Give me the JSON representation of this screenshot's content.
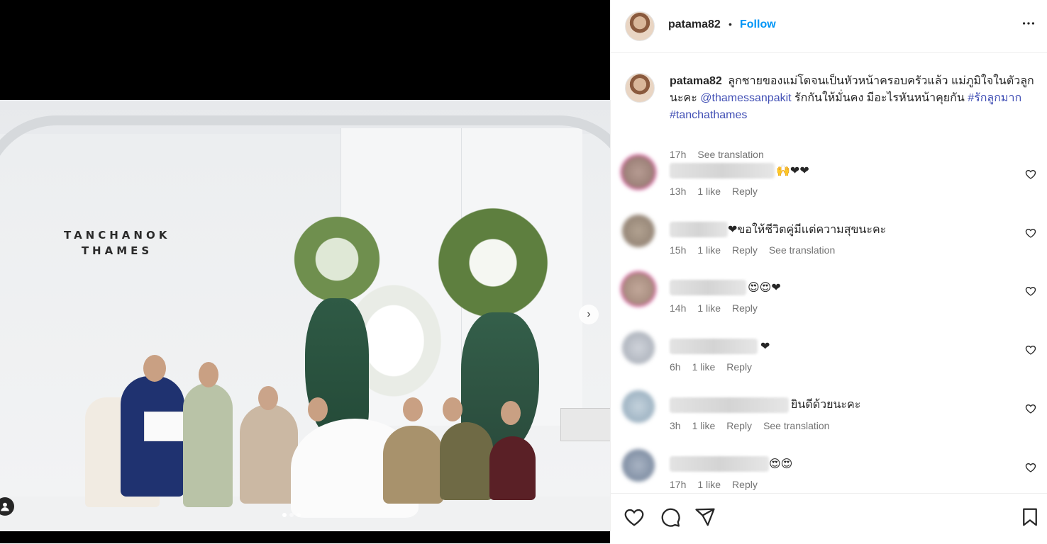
{
  "post": {
    "username": "patama82",
    "follow_label": "Follow",
    "separator": "•",
    "more_label": "•••",
    "photo": {
      "brand_line1": "TANCHANOK",
      "brand_line2": "THAMES",
      "next_label": "›"
    }
  },
  "caption": {
    "username": "patama82",
    "text_part1": "ลูกชายของแม่โตจนเป็นหัวหน้าครอบครัวแล้ว แม่ภูมิใจในตัวลูกนะคะ ",
    "mention": "@thamessanpakit",
    "text_part2": " รักกันให้มั่นคง มีอะไรหันหน้าคุยกัน ",
    "hashtag1": "#รักลูกมาก",
    "hashtag2": "#tanchathames",
    "time": "17h",
    "see_translation": "See translation"
  },
  "comments": [
    {
      "text": "🙌❤❤",
      "time": "13h",
      "likes": "1 like",
      "reply": "Reply",
      "see_translation": ""
    },
    {
      "text": "❤ขอให้ชีวิตคู่มีแต่ความสุขนะคะ",
      "time": "15h",
      "likes": "1 like",
      "reply": "Reply",
      "see_translation": "See translation"
    },
    {
      "text": "😍😍❤",
      "time": "14h",
      "likes": "1 like",
      "reply": "Reply",
      "see_translation": ""
    },
    {
      "text": "❤",
      "time": "6h",
      "likes": "1 like",
      "reply": "Reply",
      "see_translation": ""
    },
    {
      "text": "ยินดีด้วยนะคะ",
      "time": "3h",
      "likes": "1 like",
      "reply": "Reply",
      "see_translation": "See translation"
    },
    {
      "text": "😍😍",
      "time": "17h",
      "likes": "1 like",
      "reply": "Reply",
      "see_translation": ""
    }
  ],
  "icons": {
    "like": "heart-icon",
    "comment": "comment-icon",
    "share": "share-icon",
    "save": "bookmark-icon"
  },
  "colors": {
    "follow": "#0095f6",
    "link": "#4250b5",
    "meta": "#737373",
    "text": "#262626"
  }
}
